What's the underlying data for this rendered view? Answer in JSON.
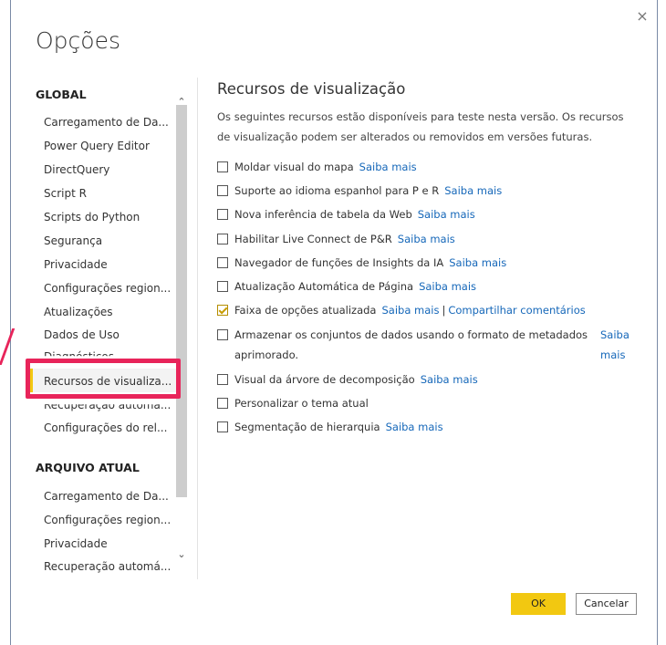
{
  "dialog": {
    "title": "Opções",
    "close_icon": "×"
  },
  "nav": {
    "global_header": "GLOBAL",
    "global_items": [
      "Carregamento de Da...",
      "Power Query Editor",
      "DirectQuery",
      "Script R",
      "Scripts do Python",
      "Segurança",
      "Privacidade",
      "Configurações region...",
      "Atualizações",
      "Dados de Uso",
      "Diagnósticos",
      "Recursos de visualiza...",
      "Recuperação automá...",
      "Configurações do rel..."
    ],
    "current_file_header": "ARQUIVO ATUAL",
    "current_file_items": [
      "Carregamento de Da...",
      "Configurações region...",
      "Privacidade",
      "Recuperação automá..."
    ],
    "scroll_up": "⌃",
    "scroll_down": "⌄"
  },
  "content": {
    "title": "Recursos de visualização",
    "description": "Os seguintes recursos estão disponíveis para teste nesta versão. Os recursos de visualização podem ser alterados ou removidos em versões futuras.",
    "features": [
      {
        "label": "Moldar visual do mapa",
        "link": "Saiba mais",
        "checked": false
      },
      {
        "label": "Suporte ao idioma espanhol para P e R",
        "link": "Saiba mais",
        "checked": false
      },
      {
        "label": "Nova inferência de tabela da Web",
        "link": "Saiba mais",
        "checked": false
      },
      {
        "label": "Habilitar Live Connect de P&R",
        "link": "Saiba mais",
        "checked": false
      },
      {
        "label": "Navegador de funções de Insights da IA",
        "link": "Saiba mais",
        "checked": false
      },
      {
        "label": "Atualização Automática de Página",
        "link": "Saiba mais",
        "checked": false
      },
      {
        "label": "Faixa de opções atualizada",
        "link": "Saiba mais",
        "extra_link": "Compartilhar comentários",
        "checked": true
      },
      {
        "label": "Armazenar os conjuntos de dados usando o formato de metadados",
        "label2": "aprimorado.",
        "link": "Saiba",
        "link2": "mais",
        "checked": false
      },
      {
        "label": "Visual da árvore de decomposição",
        "link": "Saiba mais",
        "checked": false
      },
      {
        "label": "Personalizar o tema atual",
        "link": "",
        "checked": false
      },
      {
        "label": "Segmentação de hierarquia",
        "link": "Saiba mais",
        "checked": false
      }
    ],
    "separator": "|"
  },
  "footer": {
    "ok_label": "OK",
    "cancel_label": "Cancelar"
  },
  "colors": {
    "accent": "#f2c811",
    "link": "#1567b9",
    "highlight": "#e8245a"
  }
}
